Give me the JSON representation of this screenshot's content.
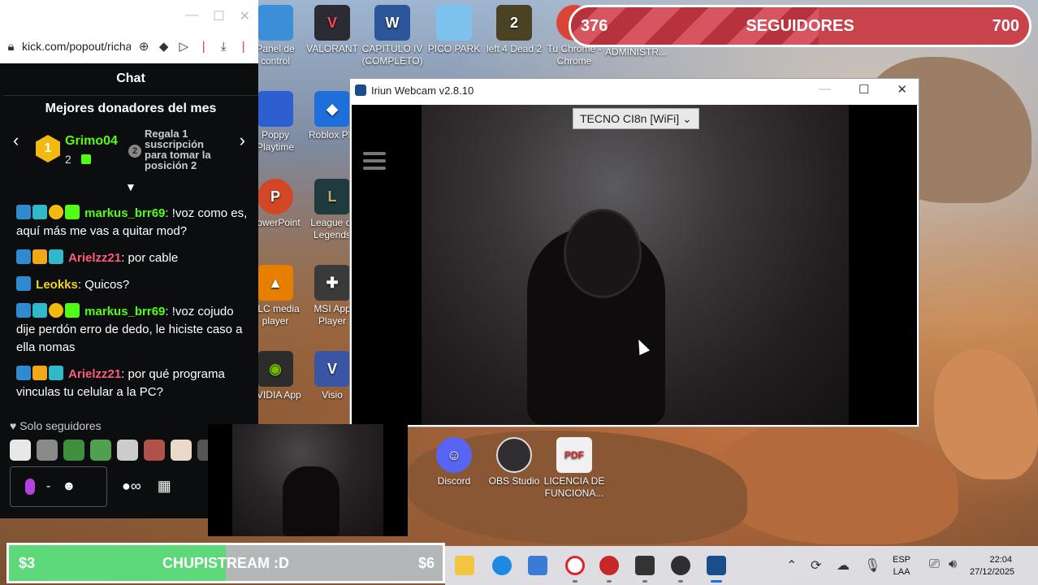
{
  "browser": {
    "url": "kick.com/popout/richard",
    "controls": [
      "minimize-icon",
      "maximize-icon",
      "close-icon"
    ]
  },
  "chat": {
    "header": "Chat",
    "donors_title": "Mejores donadores del mes",
    "top_donor": {
      "rank": "1",
      "name": "Grimo04",
      "count": "2"
    },
    "next_rank": "2",
    "next_hint": "Regala 1 suscripción para tomar la posición 2",
    "messages": [
      {
        "user": "markus_brr69",
        "text": ": !voz como es, aquí más me vas a quitar mod?"
      },
      {
        "user": "Arielzz21",
        "text": ": por cable"
      },
      {
        "user": "Leokks",
        "text": ": Quicos?"
      },
      {
        "user": "markus_brr69",
        "text": ": !voz cojudo dije perdón erro de dedo, le hiciste caso a ella nomas"
      },
      {
        "user": "Arielzz21",
        "text": ": por qué programa vinculas tu celular a la PC?"
      }
    ],
    "followers_only": "Solo seguidores",
    "input_separator": "-"
  },
  "goal": {
    "from": "376",
    "label": "SEGUIDORES",
    "to": "700",
    "progress": 0.54
  },
  "desktop_icons": [
    {
      "label": "Panel de control"
    },
    {
      "label": "VALORANT"
    },
    {
      "label": "CAPITULO IV (COMPLETO)"
    },
    {
      "label": "PICO PARK"
    },
    {
      "label": "left 4 Dead 2"
    },
    {
      "label": "Tu Chrome - Chrome"
    },
    {
      "label": "RESOLUCION ADMINISTR..."
    },
    {
      "label": "Poppy Playtime"
    },
    {
      "label": "Roblox Pla"
    },
    {
      "label": "PowerPoint"
    },
    {
      "label": "League of Legends"
    },
    {
      "label": "VLC media player"
    },
    {
      "label": "MSI App Player"
    },
    {
      "label": "NVIDIA App"
    },
    {
      "label": "Visio"
    },
    {
      "label": "Discord"
    },
    {
      "label": "OBS Studio"
    },
    {
      "label": "LICENCIA DE FUNCIONA..."
    }
  ],
  "iriun": {
    "title": "Iriun Webcam v2.8.10",
    "device": "TECNO CI8n [WiFi]"
  },
  "ticker": {
    "from": "$3",
    "label": "CHUPISTREAM :D",
    "to": "$6",
    "progress": 0.5
  },
  "taskbar": {
    "language": "ESP",
    "layout": "LAA",
    "time": "22:04",
    "date": "27/12/2025"
  },
  "colors": {
    "kick_green": "#53fc18",
    "chat_bg": "#0b0d0e",
    "goal_red": "#c9434d",
    "ticker_green": "#5dd97a"
  }
}
